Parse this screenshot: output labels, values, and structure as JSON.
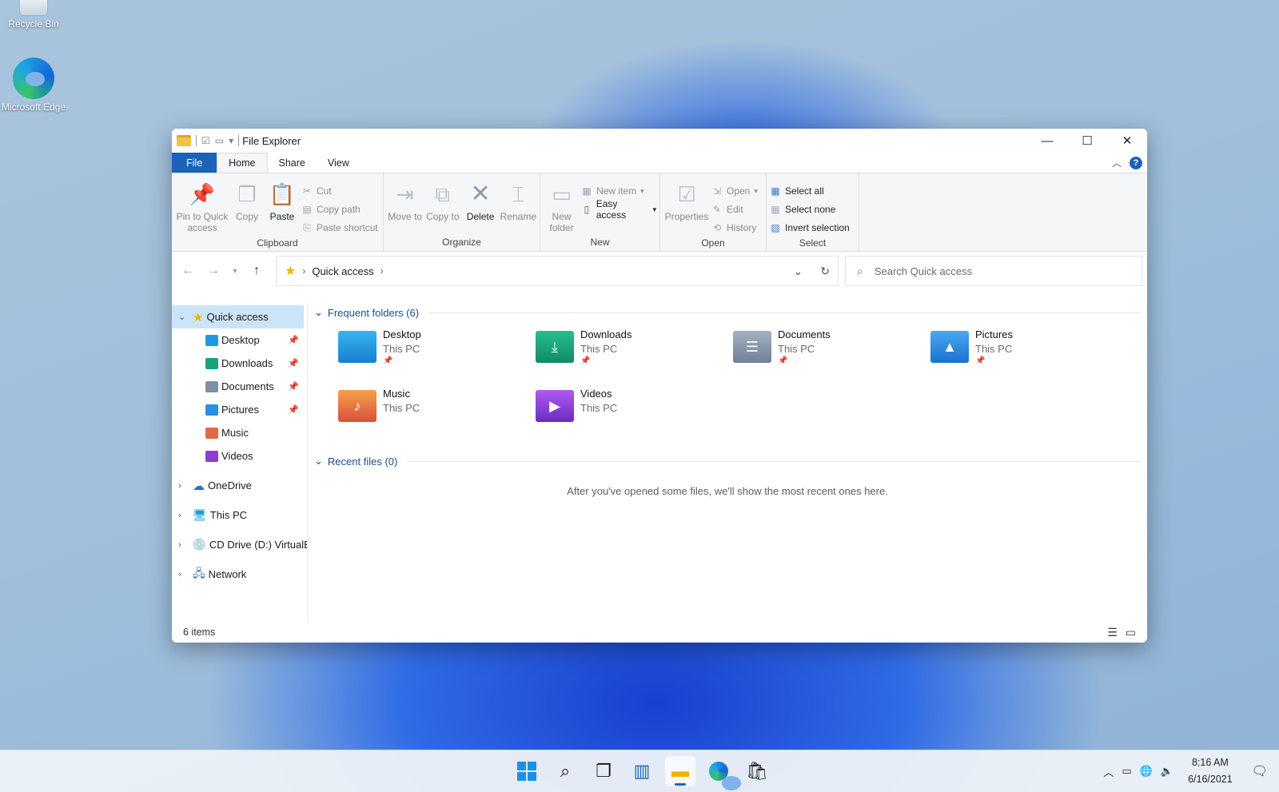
{
  "desktop": {
    "icons": [
      {
        "label": "Recycle Bin",
        "icon": "recycle-bin-icon"
      },
      {
        "label": "Microsoft Edge",
        "icon": "edge-icon"
      }
    ]
  },
  "window": {
    "title": "File Explorer",
    "tabs": {
      "file": "File",
      "home": "Home",
      "share": "Share",
      "view": "View"
    },
    "ribbon": {
      "clipboard": {
        "label": "Clipboard",
        "pin": "Pin to Quick access",
        "copy": "Copy",
        "paste": "Paste",
        "cut": "Cut",
        "copy_path": "Copy path",
        "paste_shortcut": "Paste shortcut"
      },
      "organize": {
        "label": "Organize",
        "move_to": "Move to",
        "copy_to": "Copy to",
        "delete": "Delete",
        "rename": "Rename"
      },
      "new": {
        "label": "New",
        "new_folder": "New folder",
        "new_item": "New item",
        "easy_access": "Easy access"
      },
      "open": {
        "label": "Open",
        "properties": "Properties",
        "open": "Open",
        "edit": "Edit",
        "history": "History"
      },
      "select": {
        "label": "Select",
        "select_all": "Select all",
        "select_none": "Select none",
        "invert": "Invert selection"
      }
    },
    "address": {
      "location": "Quick access",
      "search_placeholder": "Search Quick access"
    },
    "sidebar": {
      "quick_access": "Quick access",
      "pinned": [
        "Desktop",
        "Downloads",
        "Documents",
        "Pictures"
      ],
      "unpinned": [
        "Music",
        "Videos"
      ],
      "roots": [
        "OneDrive",
        "This PC",
        "CD Drive (D:) VirtualB",
        "Network"
      ]
    },
    "frequent": {
      "header": "Frequent folders (6)",
      "folders": [
        {
          "name": "Desktop",
          "location": "This PC",
          "color": "#1e9be0"
        },
        {
          "name": "Downloads",
          "location": "This PC",
          "color": "#1aa37a"
        },
        {
          "name": "Documents",
          "location": "This PC",
          "color": "#7e8fa6"
        },
        {
          "name": "Pictures",
          "location": "This PC",
          "color": "#2a8fe0"
        },
        {
          "name": "Music",
          "location": "This PC",
          "color": "#e06a45"
        },
        {
          "name": "Videos",
          "location": "This PC",
          "color": "#8a3fd1"
        }
      ]
    },
    "recent": {
      "header": "Recent files (0)",
      "empty_message": "After you've opened some files, we'll show the most recent ones here."
    },
    "status": {
      "items": "6 items"
    }
  },
  "taskbar": {
    "time": "8:16 AM",
    "date": "6/16/2021",
    "accent": "#1a63b8"
  }
}
